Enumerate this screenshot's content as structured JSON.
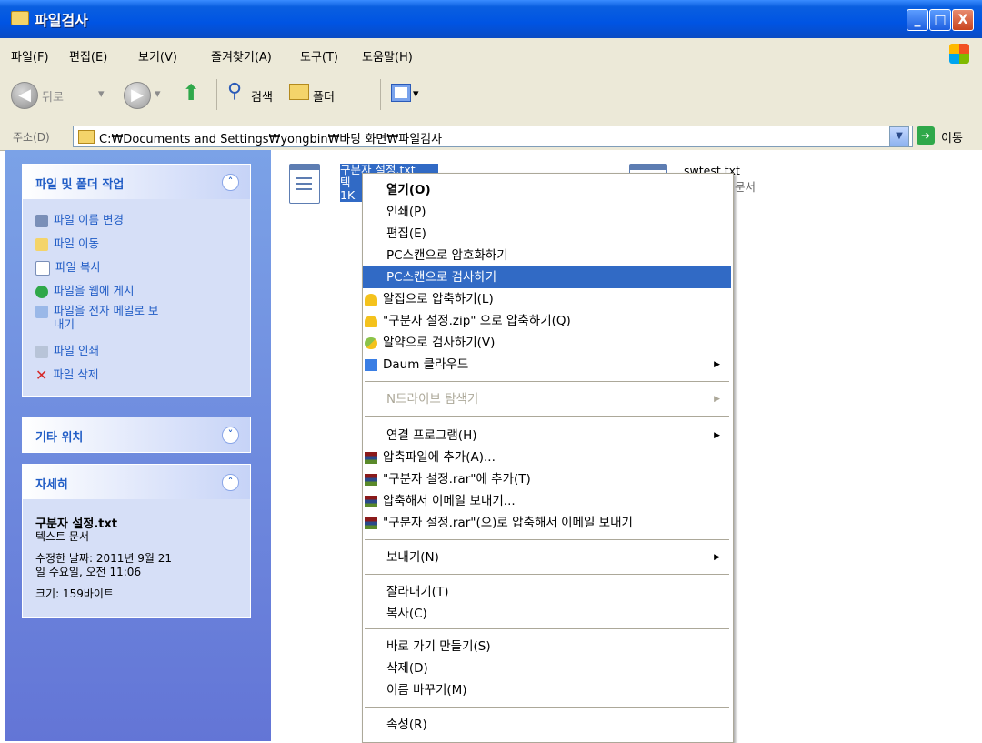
{
  "title": "파일검사",
  "window_buttons": {
    "minimize": "_",
    "maximize": "□",
    "close": "X"
  },
  "menu": [
    "파일(F)",
    "편집(E)",
    "보기(V)",
    "즐겨찾기(A)",
    "도구(T)",
    "도움말(H)"
  ],
  "toolbar": {
    "back": "뒤로",
    "search": "검색",
    "folders": "폴더"
  },
  "address": {
    "label": "주소(D)",
    "path": "C:₩Documents and Settings₩yongbin₩바탕 화면₩파일검사",
    "go": "이동"
  },
  "left": {
    "tasks_title": "파일 및 폴더 작업",
    "tasks": [
      "파일 이름 변경",
      "파일 이동",
      "파일 복사",
      "파일을 웹에 게시",
      "파일을 전자 메일로 보",
      "내기",
      "파일 인쇄",
      "파일 삭제"
    ],
    "other_title": "기타 위치",
    "details_title": "자세히",
    "details": {
      "name": "구분자 설정.txt",
      "type": "텍스트 문서",
      "modified_1": "수정한 날짜: 2011년 9월 21",
      "modified_2": "일 수요일, 오전 11:06",
      "size": "크기: 159바이트"
    }
  },
  "files": [
    {
      "name": "구분자 설정.txt",
      "line2": "텍",
      "line3": "1K"
    },
    {
      "name": "swtest.txt",
      "type": "문서"
    }
  ],
  "context_menu": {
    "items": [
      {
        "label": "열기(O)"
      },
      {
        "label": "인쇄(P)"
      },
      {
        "label": "편집(E)"
      },
      {
        "label": "PC스캔으로 암호화하기"
      },
      {
        "label": "PC스캔으로 검사하기",
        "highlighted": true
      },
      {
        "label": "알집으로 압축하기(L)",
        "icon": "alzip-icon"
      },
      {
        "label": "\"구분자 설정.zip\" 으로 압축하기(Q)",
        "icon": "alzip-icon"
      },
      {
        "label": "알약으로 검사하기(V)",
        "icon": "alyac-icon"
      },
      {
        "label": "Daum 클라우드",
        "icon": "daum-cloud-icon",
        "submenu": true
      },
      {
        "label": "N드라이브 탐색기",
        "disabled": true,
        "submenu": true
      },
      {
        "label": "연결 프로그램(H)",
        "submenu": true
      },
      {
        "label": "압축파일에 추가(A)...",
        "icon": "winrar-icon"
      },
      {
        "label": "\"구분자 설정.rar\"에 추가(T)",
        "icon": "winrar-icon"
      },
      {
        "label": "압축해서 이메일 보내기...",
        "icon": "winrar-icon"
      },
      {
        "label": "\"구분자 설정.rar\"(으)로 압축해서 이메일 보내기",
        "icon": "winrar-icon"
      },
      {
        "label": "보내기(N)",
        "submenu": true
      },
      {
        "label": "잘라내기(T)"
      },
      {
        "label": "복사(C)"
      },
      {
        "label": "바로 가기 만들기(S)"
      },
      {
        "label": "삭제(D)"
      },
      {
        "label": "이름 바꾸기(M)"
      },
      {
        "label": "속성(R)"
      }
    ]
  },
  "colors": {
    "titlebar": "#0054e3",
    "highlight": "#316ac5",
    "taskpane": "#7ba2e7",
    "link": "#215dc6"
  }
}
